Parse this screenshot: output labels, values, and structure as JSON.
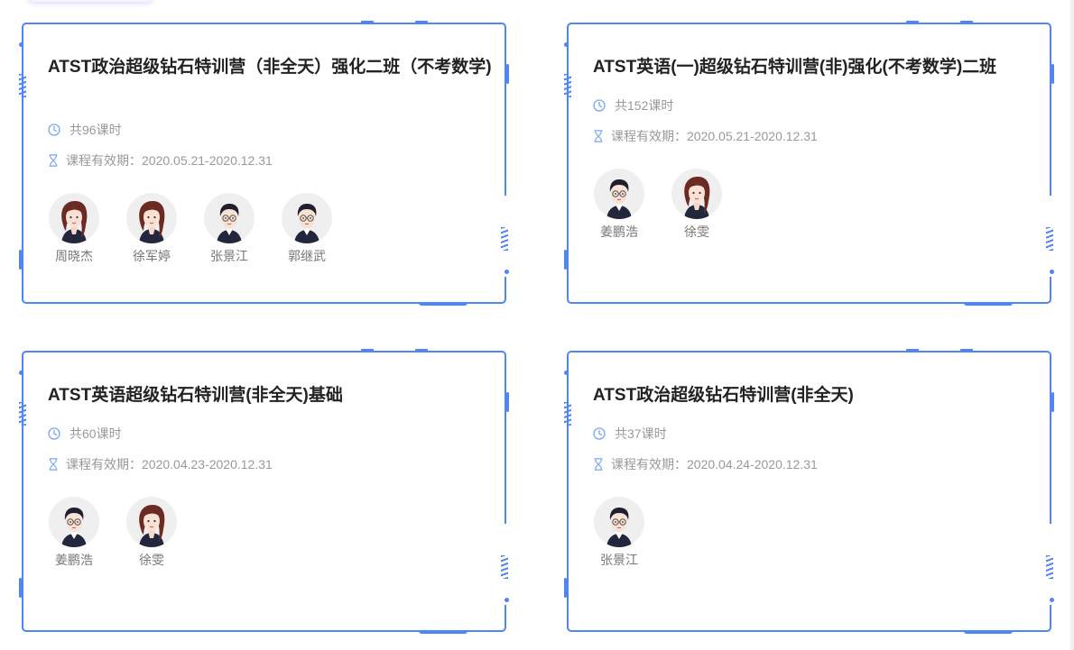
{
  "courses": [
    {
      "title": "ATST政治超级钻石特训营（非全天）强化二班（不考数学)",
      "lessons": "共96课时",
      "validity": "课程有效期：2020.05.21-2020.12.31",
      "teachers": [
        {
          "name": "周晓杰",
          "gender": "female"
        },
        {
          "name": "徐军婷",
          "gender": "female"
        },
        {
          "name": "张景江",
          "gender": "male"
        },
        {
          "name": "郭继武",
          "gender": "male"
        }
      ]
    },
    {
      "title": "ATST英语(一)超级钻石特训营(非)强化(不考数学)二班",
      "lessons": "共152课时",
      "validity": "课程有效期：2020.05.21-2020.12.31",
      "teachers": [
        {
          "name": "姜鹏浩",
          "gender": "male"
        },
        {
          "name": "徐雯",
          "gender": "female"
        }
      ]
    },
    {
      "title": "ATST英语超级钻石特训营(非全天)基础",
      "lessons": "共60课时",
      "validity": "课程有效期：2020.04.23-2020.12.31",
      "teachers": [
        {
          "name": "姜鹏浩",
          "gender": "male"
        },
        {
          "name": "徐雯",
          "gender": "female"
        }
      ]
    },
    {
      "title": "ATST政治超级钻石特训营(非全天)",
      "lessons": "共37课时",
      "validity": "课程有效期：2020.04.24-2020.12.31",
      "teachers": [
        {
          "name": "张景江",
          "gender": "male"
        }
      ]
    }
  ],
  "icons": {
    "lessons": "clock-icon",
    "validity": "hourglass-icon"
  },
  "colors": {
    "accent": "#4f86f7",
    "title": "#222222",
    "meta": "#999999",
    "teacher_name": "#777777"
  }
}
